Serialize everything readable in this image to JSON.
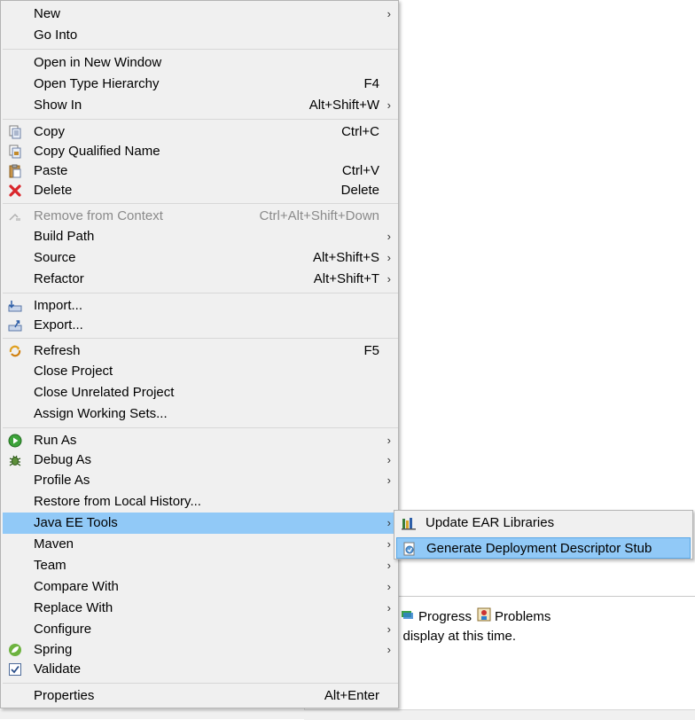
{
  "menu": {
    "items": [
      {
        "label": "New",
        "shortcut": "",
        "arrow": true,
        "icon": ""
      },
      {
        "label": "Go Into",
        "shortcut": "",
        "arrow": false,
        "icon": ""
      },
      {
        "label": "Open in New Window",
        "shortcut": "",
        "arrow": false,
        "icon": ""
      },
      {
        "label": "Open Type Hierarchy",
        "shortcut": "F4",
        "arrow": false,
        "icon": ""
      },
      {
        "label": "Show In",
        "shortcut": "Alt+Shift+W",
        "arrow": true,
        "icon": ""
      },
      {
        "label": "Copy",
        "shortcut": "Ctrl+C",
        "arrow": false,
        "icon": "copy-icon"
      },
      {
        "label": "Copy Qualified Name",
        "shortcut": "",
        "arrow": false,
        "icon": "copy-qualified-name-icon"
      },
      {
        "label": "Paste",
        "shortcut": "Ctrl+V",
        "arrow": false,
        "icon": "paste-icon"
      },
      {
        "label": "Delete",
        "shortcut": "Delete",
        "arrow": false,
        "icon": "delete-icon"
      },
      {
        "label": "Remove from Context",
        "shortcut": "Ctrl+Alt+Shift+Down",
        "arrow": false,
        "icon": "remove-context-icon",
        "disabled": true
      },
      {
        "label": "Build Path",
        "shortcut": "",
        "arrow": true,
        "icon": ""
      },
      {
        "label": "Source",
        "shortcut": "Alt+Shift+S",
        "arrow": true,
        "icon": ""
      },
      {
        "label": "Refactor",
        "shortcut": "Alt+Shift+T",
        "arrow": true,
        "icon": ""
      },
      {
        "label": "Import...",
        "shortcut": "",
        "arrow": false,
        "icon": "import-icon"
      },
      {
        "label": "Export...",
        "shortcut": "",
        "arrow": false,
        "icon": "export-icon"
      },
      {
        "label": "Refresh",
        "shortcut": "F5",
        "arrow": false,
        "icon": "refresh-icon"
      },
      {
        "label": "Close Project",
        "shortcut": "",
        "arrow": false,
        "icon": ""
      },
      {
        "label": "Close Unrelated Project",
        "shortcut": "",
        "arrow": false,
        "icon": ""
      },
      {
        "label": "Assign Working Sets...",
        "shortcut": "",
        "arrow": false,
        "icon": ""
      },
      {
        "label": "Run As",
        "shortcut": "",
        "arrow": true,
        "icon": "run-icon"
      },
      {
        "label": "Debug As",
        "shortcut": "",
        "arrow": true,
        "icon": "debug-icon"
      },
      {
        "label": "Profile As",
        "shortcut": "",
        "arrow": true,
        "icon": ""
      },
      {
        "label": "Restore from Local History...",
        "shortcut": "",
        "arrow": false,
        "icon": ""
      },
      {
        "label": "Java EE Tools",
        "shortcut": "",
        "arrow": true,
        "icon": "",
        "selected": true
      },
      {
        "label": "Maven",
        "shortcut": "",
        "arrow": true,
        "icon": ""
      },
      {
        "label": "Team",
        "shortcut": "",
        "arrow": true,
        "icon": ""
      },
      {
        "label": "Compare With",
        "shortcut": "",
        "arrow": true,
        "icon": ""
      },
      {
        "label": "Replace With",
        "shortcut": "",
        "arrow": true,
        "icon": ""
      },
      {
        "label": "Configure",
        "shortcut": "",
        "arrow": true,
        "icon": ""
      },
      {
        "label": "Spring",
        "shortcut": "",
        "arrow": true,
        "icon": "spring-icon"
      },
      {
        "label": "Validate",
        "shortcut": "",
        "arrow": false,
        "icon": "validate-checkbox-icon"
      },
      {
        "label": "Properties",
        "shortcut": "Alt+Enter",
        "arrow": false,
        "icon": ""
      }
    ]
  },
  "submenu": {
    "items": [
      {
        "label": "Update EAR Libraries",
        "icon": "ear-libraries-icon"
      },
      {
        "label": "Generate Deployment Descriptor Stub",
        "icon": "deployment-descriptor-icon",
        "selected": true
      }
    ]
  },
  "background": {
    "tabs": [
      {
        "label": "Progress",
        "icon": "progress-icon"
      },
      {
        "label": "Problems",
        "icon": "problems-icon"
      }
    ],
    "message": "o display at this time."
  },
  "colors": {
    "menu_bg": "#f0f0f0",
    "selection": "#91c9f7",
    "disabled_text": "#8a8a8a"
  }
}
